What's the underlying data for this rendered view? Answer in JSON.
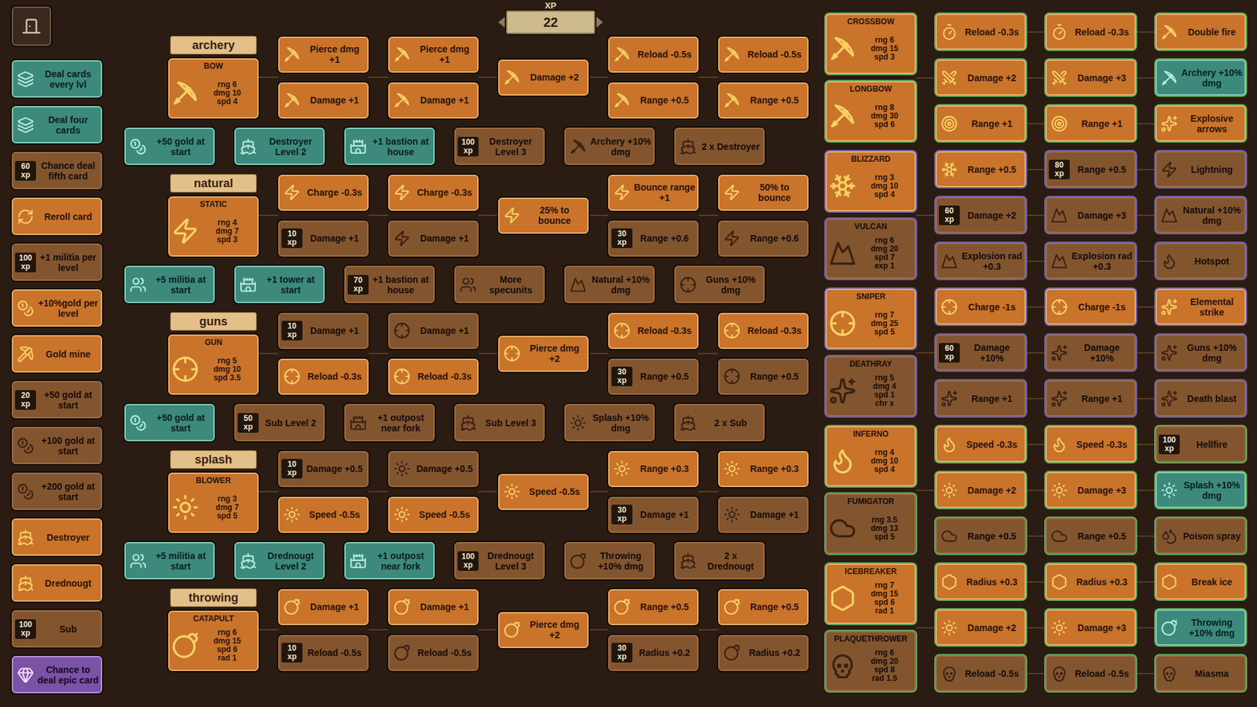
{
  "xp": {
    "label": "XP",
    "value": "22"
  },
  "sidebar": [
    {
      "label": "Deal cards every lvl",
      "state": "owned"
    },
    {
      "label": "Deal four cards",
      "state": "owned"
    },
    {
      "label": "Chance deal fifth card",
      "state": "locked",
      "xp": "60 xp"
    },
    {
      "label": "Reroll card",
      "state": "available"
    },
    {
      "label": "+1 militia per level",
      "state": "locked",
      "xp": "100 xp"
    },
    {
      "label": "+10%gold per level",
      "state": "available"
    },
    {
      "label": "Gold mine",
      "state": "available"
    },
    {
      "label": "+50 gold at start",
      "state": "locked",
      "xp": "20 xp"
    },
    {
      "label": "+100 gold at start",
      "state": "locked"
    },
    {
      "label": "+200 gold at start",
      "state": "locked"
    },
    {
      "label": "Destroyer",
      "state": "available"
    },
    {
      "label": "Drednougt",
      "state": "available"
    },
    {
      "label": "Sub",
      "state": "locked",
      "xp": "100 xp"
    },
    {
      "label": "Chance to deal epic card",
      "state": "epic"
    }
  ],
  "categories": [
    {
      "name": "archery",
      "tower": {
        "name": "BOW",
        "stats": [
          "rng 6",
          "dmg 10",
          "spd 4"
        ],
        "state": "available"
      },
      "upgrades": [
        [
          {
            "label": "Pierce dmg +1",
            "state": "available"
          },
          {
            "label": "Damage +1",
            "state": "available"
          }
        ],
        [
          {
            "label": "Pierce dmg +1",
            "state": "available"
          },
          {
            "label": "Damage +1",
            "state": "available"
          }
        ],
        [
          {
            "label": "Damage +2",
            "state": "available"
          }
        ],
        [
          {
            "label": "Reload -0.5s",
            "state": "available"
          },
          {
            "label": "Range +0.5",
            "state": "available"
          }
        ],
        [
          {
            "label": "Reload -0.5s",
            "state": "available"
          },
          {
            "label": "Range +0.5",
            "state": "available"
          }
        ]
      ],
      "unlocks": [
        {
          "label": "+50 gold at start",
          "state": "owned"
        },
        {
          "label": "Destroyer Level 2",
          "state": "owned"
        },
        {
          "label": "+1 bastion at house",
          "state": "owned"
        },
        {
          "label": "Destroyer Level 3",
          "state": "locked",
          "xp": "100 xp"
        },
        {
          "label": "Archery +10% dmg",
          "state": "locked"
        },
        {
          "label": "2 x Destroyer",
          "state": "locked"
        }
      ]
    },
    {
      "name": "natural",
      "tower": {
        "name": "STATIC",
        "stats": [
          "rng 4",
          "dmg 7",
          "spd 3"
        ],
        "state": "available"
      },
      "upgrades": [
        [
          {
            "label": "Charge -0.3s",
            "state": "available"
          },
          {
            "label": "Damage +1",
            "state": "locked",
            "xp": "10 xp"
          }
        ],
        [
          {
            "label": "Charge -0.3s",
            "state": "available"
          },
          {
            "label": "Damage +1",
            "state": "locked"
          }
        ],
        [
          {
            "label": "25% to bounce",
            "state": "available"
          }
        ],
        [
          {
            "label": "Bounce range +1",
            "state": "available"
          },
          {
            "label": "Range +0.6",
            "state": "locked",
            "xp": "30 xp"
          }
        ],
        [
          {
            "label": "50% to bounce",
            "state": "available"
          },
          {
            "label": "Range +0.6",
            "state": "locked"
          }
        ]
      ],
      "unlocks": [
        {
          "label": "+5 militia at start",
          "state": "owned"
        },
        {
          "label": "+1 tower at start",
          "state": "owned"
        },
        {
          "label": "+1 bastion at house",
          "state": "locked",
          "xp": "70 xp"
        },
        {
          "label": "More specunits",
          "state": "locked"
        },
        {
          "label": "Natural +10% dmg",
          "state": "locked"
        },
        {
          "label": "Guns +10% dmg",
          "state": "locked"
        }
      ]
    },
    {
      "name": "guns",
      "tower": {
        "name": "GUN",
        "stats": [
          "rng 5",
          "dmg 10",
          "spd 3.5"
        ],
        "state": "available"
      },
      "upgrades": [
        [
          {
            "label": "Damage +1",
            "state": "locked",
            "xp": "10 xp"
          },
          {
            "label": "Reload -0.3s",
            "state": "available"
          }
        ],
        [
          {
            "label": "Damage +1",
            "state": "locked"
          },
          {
            "label": "Reload -0.3s",
            "state": "available"
          }
        ],
        [
          {
            "label": "Pierce dmg +2",
            "state": "available"
          }
        ],
        [
          {
            "label": "Reload -0.3s",
            "state": "available"
          },
          {
            "label": "Range +0.5",
            "state": "locked",
            "xp": "30 xp"
          }
        ],
        [
          {
            "label": "Reload -0.3s",
            "state": "available"
          },
          {
            "label": "Range +0.5",
            "state": "locked"
          }
        ]
      ],
      "unlocks": [
        {
          "label": "+50 gold at start",
          "state": "owned"
        },
        {
          "label": "Sub Level 2",
          "state": "locked",
          "xp": "50 xp"
        },
        {
          "label": "+1 outpost near fork",
          "state": "locked"
        },
        {
          "label": "Sub Level 3",
          "state": "locked"
        },
        {
          "label": "Splash +10% dmg",
          "state": "locked"
        },
        {
          "label": "2 x Sub",
          "state": "locked"
        }
      ]
    },
    {
      "name": "splash",
      "tower": {
        "name": "BLOWER",
        "stats": [
          "rng 3",
          "dmg 7",
          "spd 5"
        ],
        "state": "available"
      },
      "upgrades": [
        [
          {
            "label": "Damage +0.5",
            "state": "locked",
            "xp": "10 xp"
          },
          {
            "label": "Speed -0.5s",
            "state": "available"
          }
        ],
        [
          {
            "label": "Damage +0.5",
            "state": "locked"
          },
          {
            "label": "Speed -0.5s",
            "state": "available"
          }
        ],
        [
          {
            "label": "Speed -0.5s",
            "state": "available"
          }
        ],
        [
          {
            "label": "Range +0.3",
            "state": "available"
          },
          {
            "label": "Damage +1",
            "state": "locked",
            "xp": "30 xp"
          }
        ],
        [
          {
            "label": "Range +0.3",
            "state": "available"
          },
          {
            "label": "Damage +1",
            "state": "locked"
          }
        ]
      ],
      "unlocks": [
        {
          "label": "+5 militia at start",
          "state": "owned"
        },
        {
          "label": "Drednougt Level 2",
          "state": "owned"
        },
        {
          "label": "+1 outpost near fork",
          "state": "owned"
        },
        {
          "label": "Drednougt Level 3",
          "state": "locked",
          "xp": "100 xp"
        },
        {
          "label": "Throwing +10% dmg",
          "state": "locked"
        },
        {
          "label": "2 x Drednougt",
          "state": "locked"
        }
      ]
    },
    {
      "name": "throwing",
      "tower": {
        "name": "CATAPULT",
        "stats": [
          "rng 6",
          "dmg 15",
          "spd 6",
          "rad 1"
        ],
        "state": "available"
      },
      "upgrades": [
        [
          {
            "label": "Damage +1",
            "state": "available"
          },
          {
            "label": "Reload -0.5s",
            "state": "locked",
            "xp": "10 xp"
          }
        ],
        [
          {
            "label": "Damage +1",
            "state": "available"
          },
          {
            "label": "Reload -0.5s",
            "state": "locked"
          }
        ],
        [
          {
            "label": "Pierce dmg +2",
            "state": "available"
          }
        ],
        [
          {
            "label": "Range +0.5",
            "state": "available"
          },
          {
            "label": "Radius +0.2",
            "state": "locked",
            "xp": "30 xp"
          }
        ],
        [
          {
            "label": "Range +0.5",
            "state": "available"
          },
          {
            "label": "Radius +0.2",
            "state": "locked"
          }
        ]
      ],
      "unlocks": []
    }
  ],
  "advanced": [
    {
      "frame": "#5fa85a",
      "towers": [
        {
          "name": "CROSSBOW",
          "stats": [
            "rng 6",
            "dmg 15",
            "spd 3"
          ],
          "state": "available"
        },
        {
          "name": "LONGBOW",
          "stats": [
            "rng 8",
            "dmg 30",
            "spd 6"
          ],
          "state": "available"
        }
      ],
      "rows": [
        [
          {
            "label": "Reload -0.3s",
            "state": "available"
          },
          {
            "label": "Reload -0.3s",
            "state": "available"
          },
          {
            "label": "Double fire",
            "state": "available"
          }
        ],
        [
          {
            "label": "Damage +2",
            "state": "available"
          },
          {
            "label": "Damage +3",
            "state": "available"
          },
          {
            "label": "Archery +10% dmg",
            "state": "owned"
          }
        ],
        [
          {
            "label": "Range +1",
            "state": "available"
          },
          {
            "label": "Range +1",
            "state": "available"
          },
          {
            "label": "Explosive arrows",
            "state": "available"
          }
        ]
      ]
    },
    {
      "frame": "#6a5fb0",
      "towers": [
        {
          "name": "BLIZZARD",
          "stats": [
            "rng 3",
            "dmg 10",
            "spd 4"
          ],
          "state": "available"
        },
        {
          "name": "VULCAN",
          "stats": [
            "rng 6",
            "dmg 20",
            "spd 7",
            "exp 1"
          ],
          "state": "locked"
        }
      ],
      "rows": [
        [
          {
            "label": "Range +0.5",
            "state": "available"
          },
          {
            "label": "Range +0.5",
            "state": "locked",
            "xp": "80 xp"
          },
          {
            "label": "Lightning",
            "state": "locked"
          }
        ],
        [
          {
            "label": "Damage +2",
            "state": "locked",
            "xp": "60 xp"
          },
          {
            "label": "Damage +3",
            "state": "locked"
          },
          {
            "label": "Natural +10% dmg",
            "state": "locked"
          }
        ],
        [
          {
            "label": "Explosion rad +0.3",
            "state": "locked"
          },
          {
            "label": "Explosion rad +0.3",
            "state": "locked"
          },
          {
            "label": "Hotspot",
            "state": "locked"
          }
        ]
      ]
    },
    {
      "frame": "#6a5fb0",
      "towers": [
        {
          "name": "SNIPER",
          "stats": [
            "rng 7",
            "dmg 25",
            "spd 5"
          ],
          "state": "available"
        },
        {
          "name": "DEATHRAY",
          "stats": [
            "rng 5",
            "dmg 4",
            "spd 1",
            "chr x"
          ],
          "state": "locked"
        }
      ],
      "rows": [
        [
          {
            "label": "Charge -1s",
            "state": "available"
          },
          {
            "label": "Charge -1s",
            "state": "available"
          },
          {
            "label": "Elemental strike",
            "state": "available"
          }
        ],
        [
          {
            "label": "Damage +10%",
            "state": "locked",
            "xp": "60 xp"
          },
          {
            "label": "Damage +10%",
            "state": "locked"
          },
          {
            "label": "Guns +10% dmg",
            "state": "locked"
          }
        ],
        [
          {
            "label": "Range +1",
            "state": "locked"
          },
          {
            "label": "Range +1",
            "state": "locked"
          },
          {
            "label": "Death blast",
            "state": "locked"
          }
        ]
      ]
    },
    {
      "frame": "#5fa85a",
      "towers": [
        {
          "name": "INFERNO",
          "stats": [
            "rng 4",
            "dmg 10",
            "spd 4"
          ],
          "state": "available"
        },
        {
          "name": "FUMIGATOR",
          "stats": [
            "rng 3.5",
            "dmg 13",
            "spd 5"
          ],
          "state": "locked"
        }
      ],
      "rows": [
        [
          {
            "label": "Speed -0.3s",
            "state": "available"
          },
          {
            "label": "Speed -0.3s",
            "state": "available"
          },
          {
            "label": "Hellfire",
            "state": "locked",
            "xp": "100 xp"
          }
        ],
        [
          {
            "label": "Damage +2",
            "state": "available"
          },
          {
            "label": "Damage +3",
            "state": "available"
          },
          {
            "label": "Splash +10% dmg",
            "state": "owned"
          }
        ],
        [
          {
            "label": "Range +0.5",
            "state": "locked"
          },
          {
            "label": "Range +0.5",
            "state": "locked"
          },
          {
            "label": "Poison spray",
            "state": "locked"
          }
        ]
      ]
    },
    {
      "frame": "#5fa85a",
      "towers": [
        {
          "name": "ICEBREAKER",
          "stats": [
            "rng 7",
            "dmg 15",
            "spd 6",
            "rad 1"
          ],
          "state": "available"
        },
        {
          "name": "PLAQUETHROWER",
          "stats": [
            "rng 6",
            "dmg 20",
            "spd 8",
            "rad 1.5"
          ],
          "state": "locked"
        }
      ],
      "rows": [
        [
          {
            "label": "Radius +0.3",
            "state": "available"
          },
          {
            "label": "Radius +0.3",
            "state": "available"
          },
          {
            "label": "Break ice",
            "state": "available"
          }
        ],
        [
          {
            "label": "Damage +2",
            "state": "available"
          },
          {
            "label": "Damage +3",
            "state": "available"
          },
          {
            "label": "Throwing +10% dmg",
            "state": "owned"
          }
        ],
        [
          {
            "label": "Reload -0.5s",
            "state": "locked"
          },
          {
            "label": "Reload -0.5s",
            "state": "locked"
          },
          {
            "label": "Miasma",
            "state": "locked"
          }
        ]
      ]
    }
  ]
}
